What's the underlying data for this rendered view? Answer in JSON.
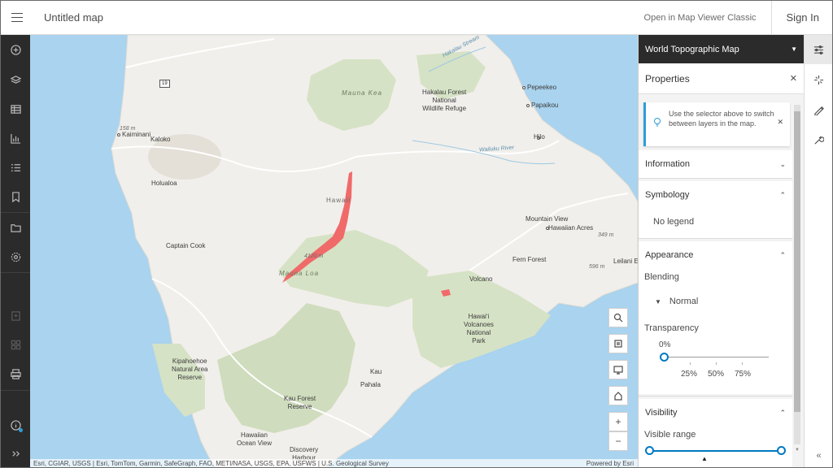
{
  "header": {
    "title": "Untitled map",
    "open_classic": "Open in Map Viewer Classic",
    "sign_in": "Sign In"
  },
  "map": {
    "labels": {
      "mauna_kea": "Mauna Kea",
      "hakalau": "Hakalau Forest\nNational\nWildlife Refuge",
      "hakalau_stream": "Hakalau Stream",
      "wailuku": "Wailuku River",
      "pepeekeo": "Pepeekeo",
      "papaikou": "Papaikou",
      "hilo": "Hilo",
      "kaiminani": "Kaiminani",
      "elev_158": "158 m",
      "kaloko": "Kaloko",
      "holualoa": "Holualoa",
      "hawaii": "Hawaii",
      "captain_cook": "Captain Cook",
      "mountain_view": "Mountain View",
      "hawaiian_acres": "Hawaiian Acres",
      "elev_349": "349 m",
      "fern_forest": "Fern Forest",
      "elev_596": "596 m",
      "leilani": "Leilani Es",
      "elev_4120": "4120 m",
      "mauna_loa": "Mauna Loa",
      "volcano": "Volcano",
      "hvnp": "Hawaiʻi\nVolcanoes\nNational\nPark",
      "kipahoehoe": "Kipahoehoe\nNatural Area\nReserve",
      "kau": "Kau",
      "pahala": "Pahala",
      "kau_forest": "Kau Forest\nReserve",
      "hov": "Hawaiian\nOcean View",
      "discovery": "Discovery\nHarbour",
      "route_19": "19"
    },
    "attribution": "Esri, CGIAR, USGS | Esri, TomTom, Garmin, SafeGraph, FAO, METI/NASA, USGS, EPA, USFWS | U.S. Geological Survey",
    "powered_by": "Powered by Esri",
    "colors": {
      "ocean": "#a9d3ee",
      "land": "#f1efeb",
      "park": "#d6e2c5",
      "lava_flow": "#f06a6a"
    }
  },
  "panel": {
    "basemap": "World Topographic Map",
    "properties_title": "Properties",
    "notice": "Use the selector above to switch between layers in the map.",
    "sections": {
      "information": "Information",
      "symbology": "Symbology",
      "no_legend": "No legend",
      "appearance": "Appearance",
      "blending_label": "Blending",
      "blending_value": "Normal",
      "transparency_label": "Transparency",
      "transparency_value": "0%",
      "tick_25": "25%",
      "tick_50": "50%",
      "tick_75": "75%",
      "visibility": "Visibility",
      "visible_range": "Visible range"
    },
    "transparency": 0
  },
  "icons": {
    "left": [
      "add-icon",
      "layers-icon",
      "table-icon",
      "chart-icon",
      "legend-icon",
      "bookmark-icon",
      "folder-icon",
      "settings-icon",
      "share-icon",
      "grid-icon",
      "print-icon",
      "info-icon",
      "expand-icon"
    ],
    "right": [
      "properties-icon",
      "effects-icon",
      "styles-icon",
      "configure-icon",
      "collapse-icon"
    ]
  }
}
